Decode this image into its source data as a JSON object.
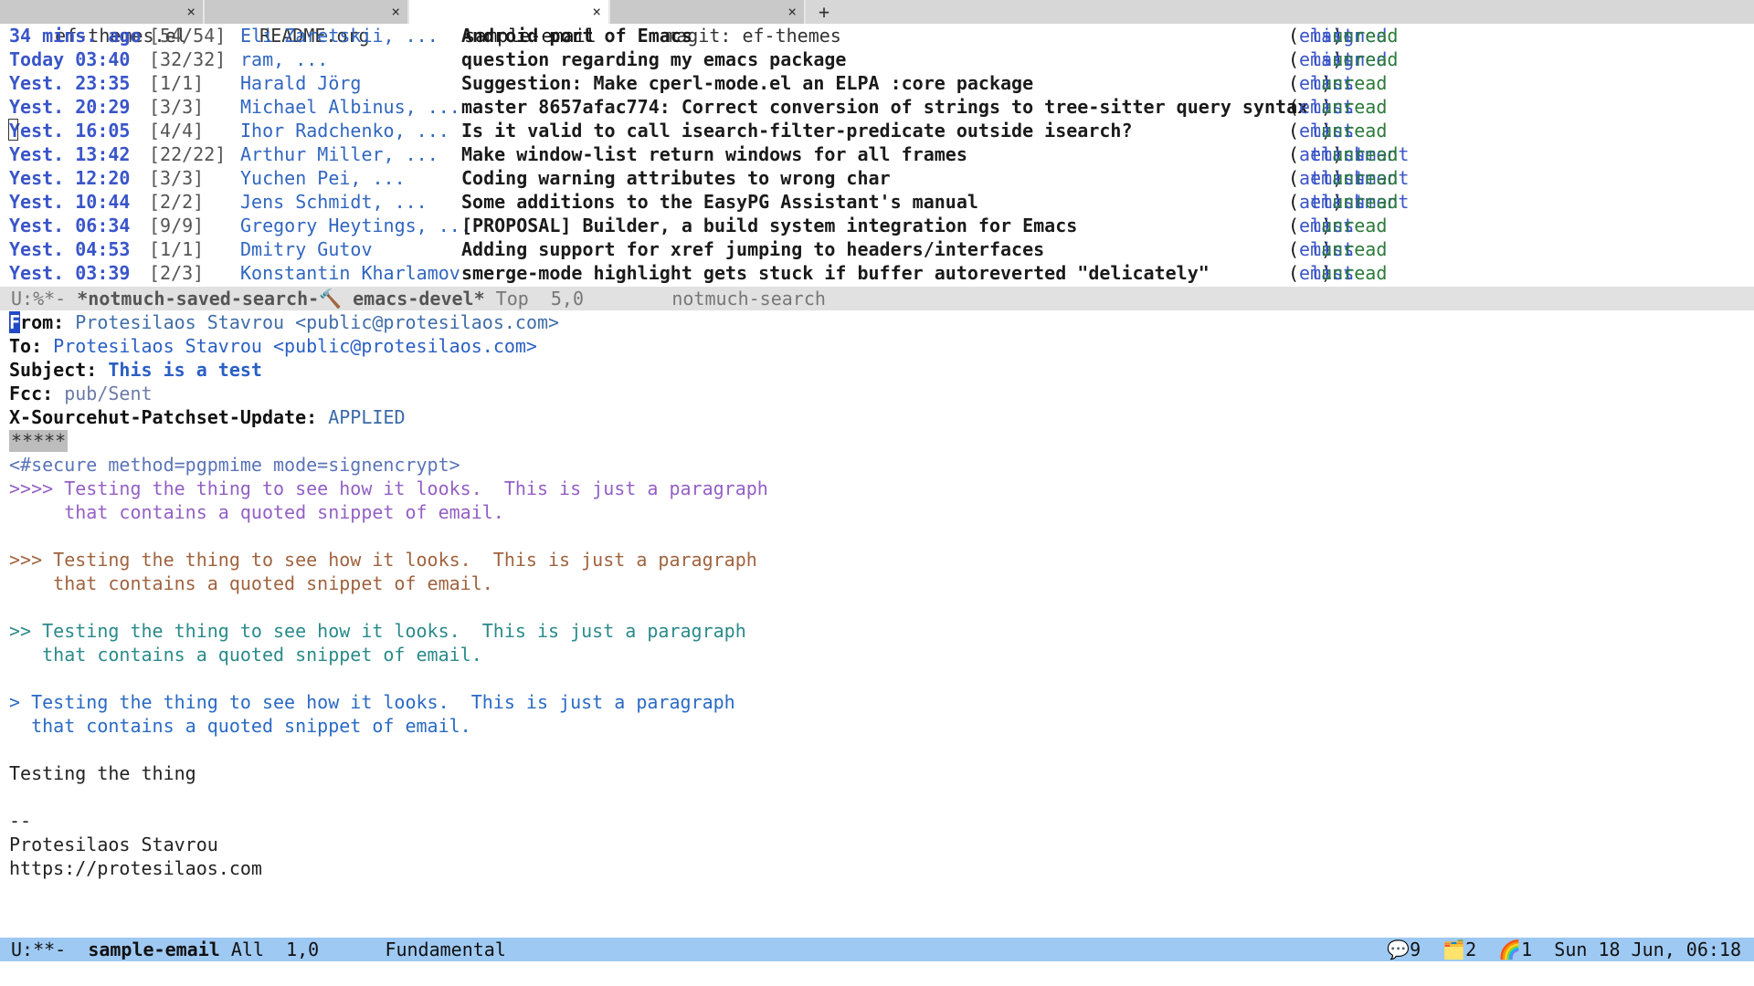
{
  "tabs": [
    {
      "label": "ef-themes.el",
      "close": "×",
      "active": false,
      "width": 228
    },
    {
      "label": "README.org",
      "close": "×",
      "active": false,
      "width": 224
    },
    {
      "label": "sample-email",
      "close": "×",
      "active": true,
      "width": 222
    },
    {
      "label": "magit: ef-themes",
      "close": "×",
      "active": false,
      "width": 216
    }
  ],
  "new_tab": "+",
  "search_rows": [
    {
      "date": "34 mins. ago",
      "count": "[54/54]",
      "authors": "Eli Zaretskii, ...",
      "subject": "Android port of Emacs",
      "tags": [
        "emacs",
        "list",
        "signed",
        "unread"
      ]
    },
    {
      "date": "Today 03:40",
      "count": "[32/32]",
      "authors": "ram, ...",
      "subject": "question regarding my emacs package",
      "tags": [
        "emacs",
        "list",
        "signed",
        "unread"
      ]
    },
    {
      "date": "Yest. 23:35",
      "count": "[1/1]",
      "authors": "Harald Jörg",
      "subject": "Suggestion: Make cperl-mode.el an ELPA :core package",
      "tags": [
        "emacs",
        "list",
        "unread"
      ]
    },
    {
      "date": "Yest. 20:29",
      "count": "[3/3]",
      "authors": "Michael Albinus, ...",
      "subject": "master 8657afac774: Correct conversion of strings to tree-sitter query syntax",
      "tags": [
        "emacs",
        "list",
        "unread"
      ]
    },
    {
      "date": "Yest. 16:05",
      "count": "[4/4]",
      "authors": "Ihor Radchenko, ...",
      "subject": "Is it valid to call isearch-filter-predicate outside isearch?",
      "tags": [
        "emacs",
        "list",
        "unread"
      ]
    },
    {
      "date": "Yest. 13:42",
      "count": "[22/22]",
      "authors": "Arthur Miller, ...",
      "subject": "Make window-list return windows for all frames",
      "tags": [
        "attachment",
        "emacs",
        "list",
        "unread"
      ]
    },
    {
      "date": "Yest. 12:20",
      "count": "[3/3]",
      "authors": "Yuchen Pei, ...",
      "subject": "Coding warning attributes to wrong char",
      "tags": [
        "attachment",
        "emacs",
        "list",
        "unread"
      ]
    },
    {
      "date": "Yest. 10:44",
      "count": "[2/2]",
      "authors": "Jens Schmidt, ...",
      "subject": "Some additions to the EasyPG Assistant's manual",
      "tags": [
        "attachment",
        "emacs",
        "list",
        "unread"
      ]
    },
    {
      "date": "Yest. 06:34",
      "count": "[9/9]",
      "authors": "Gregory Heytings, ...",
      "subject": "[PROPOSAL] Builder, a build system integration for Emacs",
      "tags": [
        "emacs",
        "list",
        "unread"
      ]
    },
    {
      "date": "Yest. 04:53",
      "count": "[1/1]",
      "authors": "Dmitry Gutov",
      "subject": "Adding support for xref jumping to headers/interfaces",
      "tags": [
        "emacs",
        "list",
        "unread"
      ]
    },
    {
      "date": "Yest. 03:39",
      "count": "[2/3]",
      "authors": "Konstantin Kharlamov",
      "subject": "smerge-mode highlight gets stuck if buffer autoreverted \"delicately\"",
      "tags": [
        "emacs",
        "list",
        "unread"
      ]
    }
  ],
  "modeline1": {
    "state": "U:%*-",
    "buffer": "*notmuch-saved-search-",
    "hammer": "🔨",
    "buffer_rest": " emacs-devel*",
    "position": "Top  5,0",
    "mode": "notmuch-search"
  },
  "email": {
    "from_key": "From:",
    "from_first": "F",
    "from_key_rest": "rom:",
    "from_val": "Protesilaos Stavrou <public@protesilaos.com>",
    "to_key": "To:",
    "to_val": "Protesilaos Stavrou <public@protesilaos.com>",
    "subject_key": "Subject:",
    "subject_val": "This is a test",
    "fcc_key": "Fcc:",
    "fcc_val": "pub/Sent",
    "x_key": "X-Sourcehut-Patchset-Update:",
    "x_val": "APPLIED",
    "separator": "*****",
    "secure": "<#secure method=pgpmime mode=signencrypt>",
    "q4a": ">>>> Testing the thing to see how it looks.  This is just a paragraph",
    "q4b": "     that contains a quoted snippet of email.",
    "q3a": ">>> Testing the thing to see how it looks.  This is just a paragraph",
    "q3b": "    that contains a quoted snippet of email.",
    "q2a": ">> Testing the thing to see how it looks.  This is just a paragraph",
    "q2b": "   that contains a quoted snippet of email.",
    "q1a": "> Testing the thing to see how it looks.  This is just a paragraph",
    "q1b": "  that contains a quoted snippet of email.",
    "body": "Testing the thing",
    "sig_dash": "--",
    "sig_name": "Protesilaos Stavrou",
    "sig_url": "https://protesilaos.com"
  },
  "modeline2": {
    "state": "U:**-",
    "buffer": "sample-email",
    "position": "All  1,0",
    "mode": "Fundamental",
    "chat_icon": "💬",
    "chat_count": "9",
    "folder_icon": "🗂️",
    "folder_count": "2",
    "rainbow_icon": "🌈",
    "rainbow_count": "1",
    "datetime": "Sun 18 Jun, 06:18"
  },
  "colors": {
    "accent_blue": "#3a55c8",
    "unread_green": "#2c7a3a",
    "modeline_active": "#9ec9f3",
    "modeline_inactive": "#e1e1e1"
  }
}
